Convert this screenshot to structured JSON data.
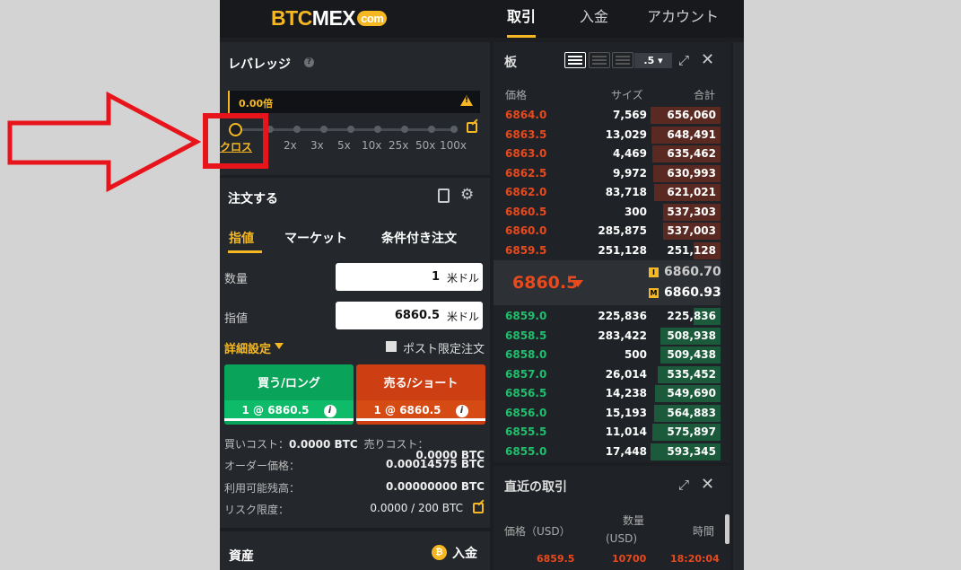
{
  "brand": {
    "part1": "BTC",
    "part2": "MEX",
    "part3": "com"
  },
  "nav": {
    "trade": "取引",
    "deposit": "入金",
    "account": "アカウント"
  },
  "leverage": {
    "title": "レバレッジ",
    "value": "0.00倍",
    "cross": "クロス",
    "ticks": [
      "2x",
      "3x",
      "5x",
      "10x",
      "25x",
      "50x",
      "100x"
    ]
  },
  "order": {
    "title": "注文する",
    "tabs": [
      "指値",
      "マーケット",
      "条件付き注文"
    ],
    "qty_label": "数量",
    "qty_value": "1",
    "qty_unit": "米ドル",
    "price_label": "指値",
    "price_value": "6860.5",
    "price_unit": "米ドル",
    "advanced": "詳細設定",
    "post_only": "ポスト限定注文",
    "buy_label": "買う/ロング",
    "buy_sub": "1 @ 6860.5",
    "sell_label": "売る/ショート",
    "sell_sub": "1 @ 6860.5",
    "buy_cost_label": "買いコスト：",
    "buy_cost_value": "0.0000 BTC",
    "sell_cost_label": "売りコスト：",
    "sell_cost_value": "0.0000 BTC",
    "order_value_label": "オーダー価格：",
    "order_value": "0.00014575 BTC",
    "available_label": "利用可能残高：",
    "available_value": "0.00000000 BTC",
    "risk_label": "リスク限度：",
    "risk_value": "0.0000 / 200 BTC"
  },
  "assets": {
    "title": "資産",
    "deposit": "入金"
  },
  "orderbook": {
    "title": "板",
    "zoom": ".5",
    "col_price": "価格",
    "col_size": "サイズ",
    "col_total": "合計",
    "asks": [
      {
        "price": "6864.0",
        "size": "7,569",
        "total": "656,060",
        "depth": 1.0
      },
      {
        "price": "6863.5",
        "size": "13,029",
        "total": "648,491",
        "depth": 0.99
      },
      {
        "price": "6863.0",
        "size": "4,469",
        "total": "635,462",
        "depth": 0.97
      },
      {
        "price": "6862.5",
        "size": "9,972",
        "total": "630,993",
        "depth": 0.96
      },
      {
        "price": "6862.0",
        "size": "83,718",
        "total": "621,021",
        "depth": 0.95
      },
      {
        "price": "6860.5",
        "size": "300",
        "total": "537,303",
        "depth": 0.82
      },
      {
        "price": "6860.0",
        "size": "285,875",
        "total": "537,003",
        "depth": 0.82
      },
      {
        "price": "6859.5",
        "size": "251,128",
        "total": "251,128",
        "depth": 0.38
      }
    ],
    "last_price": "6860.5",
    "index_price": "6860.70",
    "mark_price": "6860.93",
    "bids": [
      {
        "price": "6859.0",
        "size": "225,836",
        "total": "225,836",
        "depth": 0.38
      },
      {
        "price": "6858.5",
        "size": "283,422",
        "total": "508,938",
        "depth": 0.86
      },
      {
        "price": "6858.0",
        "size": "500",
        "total": "509,438",
        "depth": 0.86
      },
      {
        "price": "6857.0",
        "size": "26,014",
        "total": "535,452",
        "depth": 0.9
      },
      {
        "price": "6856.5",
        "size": "14,238",
        "total": "549,690",
        "depth": 0.93
      },
      {
        "price": "6856.0",
        "size": "15,193",
        "total": "564,883",
        "depth": 0.95
      },
      {
        "price": "6855.5",
        "size": "11,014",
        "total": "575,897",
        "depth": 0.97
      },
      {
        "price": "6855.0",
        "size": "17,448",
        "total": "593,345",
        "depth": 1.0
      }
    ]
  },
  "trades": {
    "title": "直近の取引",
    "col_price": "価格（USD）",
    "col_qty_top": "数量",
    "col_qty_bottom": "(USD)",
    "col_time": "時間",
    "rows": [
      {
        "price": "6859.5",
        "qty": "10700",
        "time": "18:20:04"
      }
    ]
  },
  "colors": {
    "accent": "#f5b822",
    "ask": "#e8491d",
    "bid": "#1fbf6d",
    "annotation": "#e8141c"
  }
}
